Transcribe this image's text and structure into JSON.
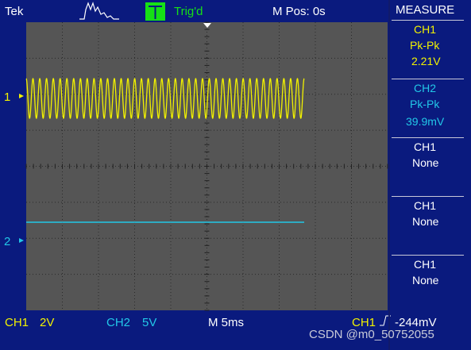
{
  "status_bar": {
    "brand": "Tek",
    "trigger_state": "Trig'd",
    "horizontal_position": "M Pos: 0s"
  },
  "menu": {
    "title": "MEASURE",
    "slots": [
      {
        "channel": "CH1",
        "measure": "Pk-Pk",
        "value": "2.21V",
        "color": "#f2f200"
      },
      {
        "channel": "CH2",
        "measure": "Pk-Pk",
        "value": "39.9mV",
        "color": "#22c8e8"
      },
      {
        "channel": "CH1",
        "measure": "None",
        "value": "",
        "color": "#ffffff"
      },
      {
        "channel": "CH1",
        "measure": "None",
        "value": "",
        "color": "#ffffff"
      },
      {
        "channel": "CH1",
        "measure": "None",
        "value": "",
        "color": "#ffffff"
      }
    ]
  },
  "markers": {
    "ch1": "1",
    "ch2": "2"
  },
  "bottom_bar": {
    "ch1_label": "CH1",
    "ch1_scale": "2V",
    "ch2_label": "CH2",
    "ch2_scale": "5V",
    "timebase": "M 5ms",
    "trigger_source": "CH1",
    "trigger_level": "-244mV"
  },
  "watermark": "CSDN @m0_50752055",
  "colors": {
    "background": "#0a1a7e",
    "graticule": "#555555",
    "ch1": "#f2f200",
    "ch2": "#22c8e8",
    "trigger_ready": "#16e016"
  },
  "waveforms": {
    "ch1": {
      "type": "sine",
      "cycles_shown": 41,
      "pk_pk": "2.21V"
    },
    "ch2": {
      "type": "flat"
    }
  }
}
